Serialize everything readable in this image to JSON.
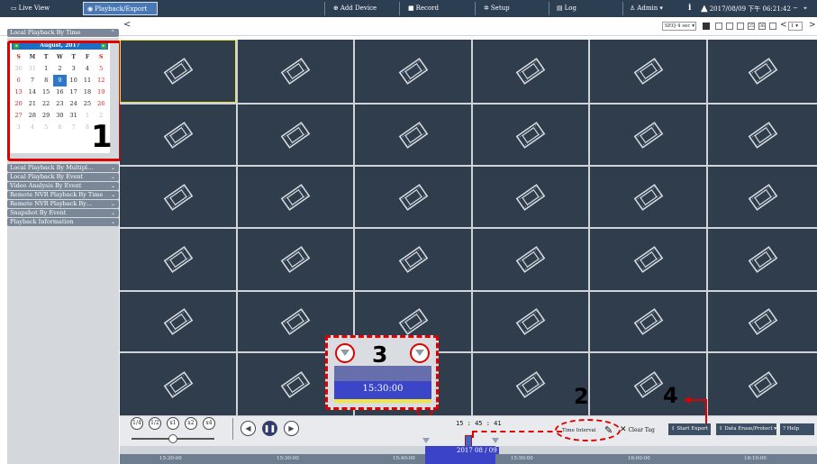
{
  "topbar": {
    "tabs": [
      {
        "label": "Live View",
        "icon": "monitor-icon"
      },
      {
        "label": "Playback/Export",
        "icon": "play-circle-icon"
      },
      {
        "label": "Add Device",
        "icon": "plus-circle-icon"
      },
      {
        "label": "Record",
        "icon": "camera-icon"
      },
      {
        "label": "Setup",
        "icon": "gear-icon"
      },
      {
        "label": "Log",
        "icon": "document-icon"
      }
    ],
    "user": "Admin",
    "info_icon": "i",
    "datetime": "2017/08/09 下午 06:21:42"
  },
  "subbar": {
    "back": "<",
    "seq": "SEQ 4 sec",
    "page": "1",
    "forward": ">",
    "layout_numbers": [
      "25",
      "36"
    ]
  },
  "sidebar": {
    "header": "Local Playback By Time",
    "calendar": {
      "month": "August, 2017",
      "dow": [
        "S",
        "M",
        "T",
        "W",
        "T",
        "F",
        "S"
      ],
      "weeks": [
        [
          "30",
          "31",
          "1",
          "2",
          "3",
          "4",
          "5"
        ],
        [
          "6",
          "7",
          "8",
          "9",
          "10",
          "11",
          "12"
        ],
        [
          "13",
          "14",
          "15",
          "16",
          "17",
          "18",
          "19"
        ],
        [
          "20",
          "21",
          "22",
          "23",
          "24",
          "25",
          "26"
        ],
        [
          "27",
          "28",
          "29",
          "30",
          "31",
          "1",
          "2"
        ],
        [
          "3",
          "4",
          "5",
          "6",
          "7",
          "8",
          "9"
        ]
      ],
      "selected": "9"
    },
    "sections": [
      "Local Playback By Multipl…",
      "Local Playback By Event",
      "Video Analysis By Event",
      "Remote NVR Playback By Time",
      "Remote NVR Playback By…",
      "Snapshot By Event",
      "Playback Information"
    ]
  },
  "annotations": {
    "one": "1",
    "two": "2",
    "three": "3",
    "four": "4"
  },
  "zoom": {
    "time": "15:30:00"
  },
  "controls": {
    "speeds": [
      "1/4",
      "1/2",
      "x1",
      "x2",
      "x4"
    ],
    "prev": "◀",
    "pause": "❚❚",
    "next": "▶",
    "time": "15 : 45 : 41",
    "time_interval": "Time Interval",
    "clear_tag": "Clear Tag",
    "start_export": "Start Export",
    "data_erase": "Data Erase/Protect",
    "help": "Help"
  },
  "timeline": {
    "date": "2017 08 / 09",
    "ticks": [
      "15:20:00",
      "15:30:00",
      "15:40:00",
      "15:50:00",
      "16:00:00",
      "16:10:00"
    ]
  }
}
